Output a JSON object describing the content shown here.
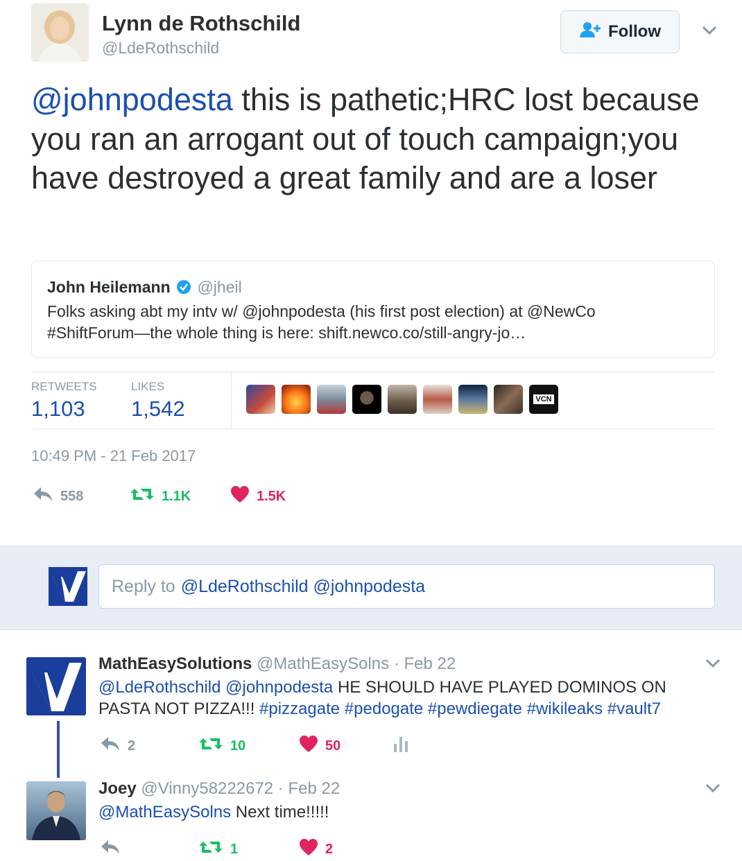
{
  "tweet": {
    "author_name": "Lynn de Rothschild",
    "author_handle": "@LdeRothschild",
    "follow_label": "Follow",
    "mention": "@johnpodesta",
    "text": " this is pathetic;HRC lost because you ran an arrogant out of touch campaign;you have destroyed a great family and are a loser",
    "retweets_label": "RETWEETS",
    "retweets_count": "1,103",
    "likes_label": "LIKES",
    "likes_count": "1,542",
    "timestamp": "10:49 PM - 21 Feb 2017",
    "reply_count": "558",
    "retweet_count_short": "1.1K",
    "like_count_short": "1.5K",
    "liker_badge_text": "VCN"
  },
  "quoted": {
    "author_name": "John Heilemann",
    "author_handle": "@jheil",
    "line1_pre": "Folks asking abt my intv w/ @johnpodesta (his first post election) at @NewCo",
    "line2": "#ShiftForum—the whole thing is here: shift.newco.co/still-angry-jo…"
  },
  "reply_box": {
    "prefix": "Reply to",
    "mentions": "@LdeRothschild @johnpodesta"
  },
  "replies": [
    {
      "name": "MathEasySolutions",
      "handle": "@MathEasySolns",
      "date": "· Feb 22",
      "mentions": "@LdeRothschild @johnpodesta",
      "text_line1": " HE SHOULD HAVE PLAYED DOMINOS ON",
      "text_line2_plain": "PASTA NOT PIZZA!!! ",
      "hashtags": "#pizzagate #pedogate #pewdiegate #wikileaks #vault7",
      "replies": "2",
      "retweets": "10",
      "likes": "50"
    },
    {
      "name": "Joey",
      "handle": "@Vinny58222672",
      "date": "· Feb 22",
      "mention": "@MathEasySolns",
      "text": " Next time!!!!!",
      "replies": "",
      "retweets": "1",
      "likes": "2"
    }
  ],
  "colors": {
    "link": "#1b4fb0",
    "retweet_green": "#17bf63",
    "like_red": "#e0245e",
    "muted": "#8899a6"
  }
}
